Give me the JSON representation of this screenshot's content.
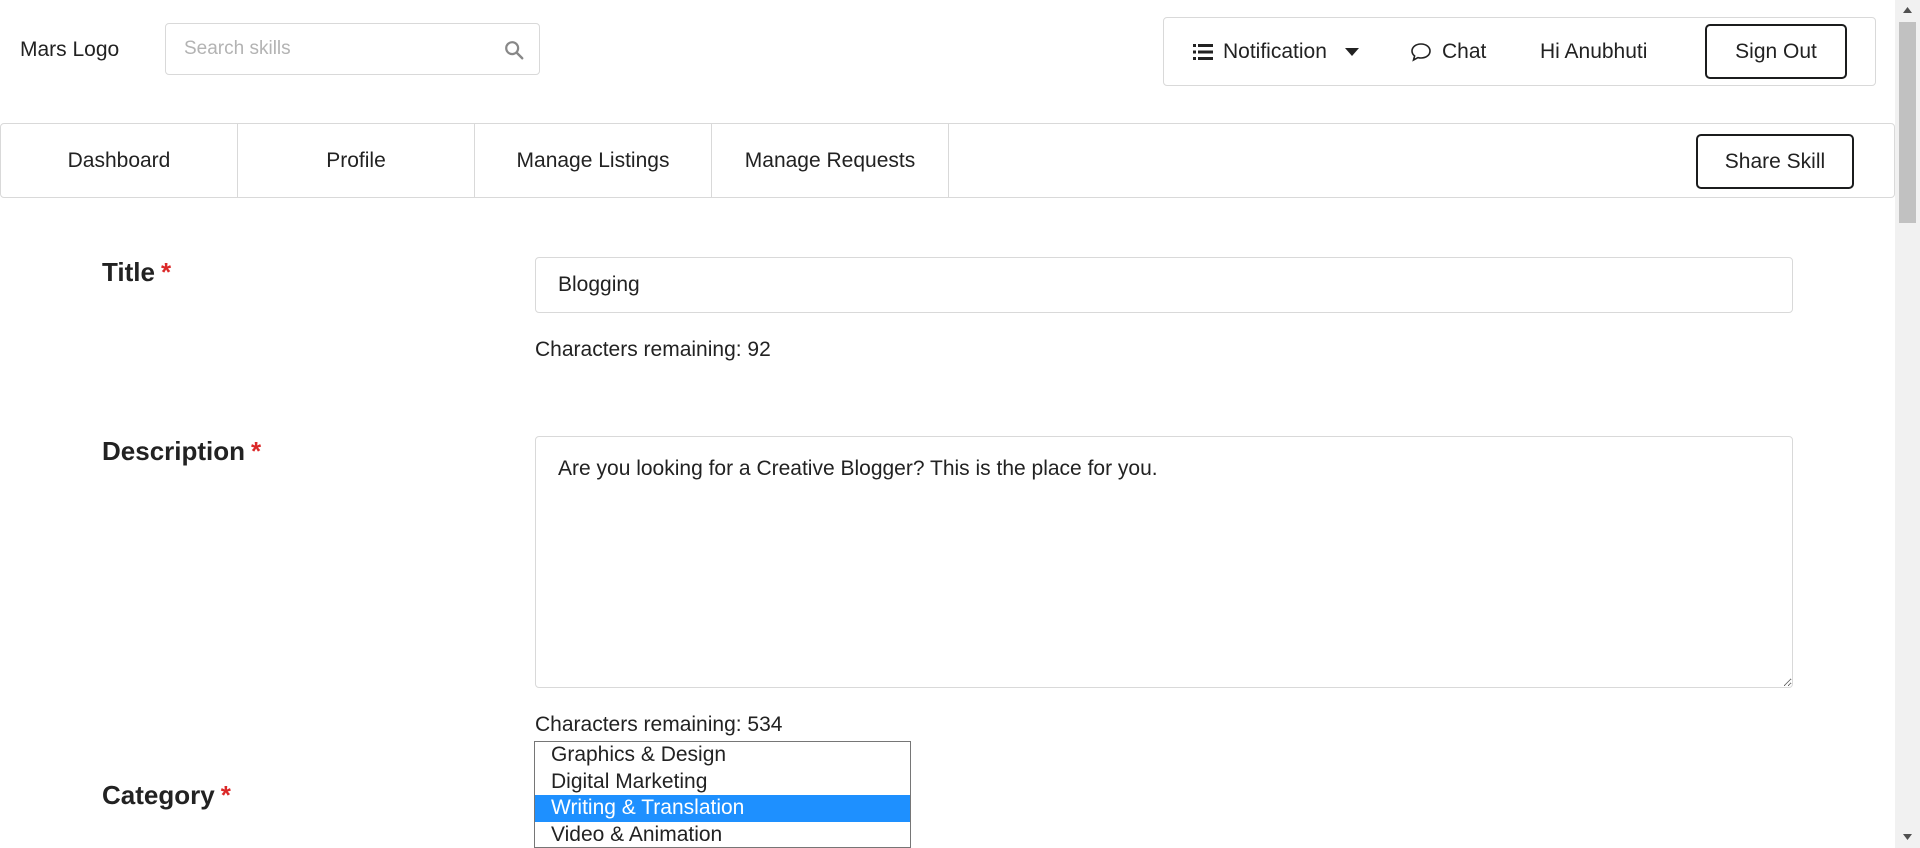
{
  "header": {
    "logo": "Mars Logo",
    "search": {
      "placeholder": "Search skills",
      "icon": "search-icon"
    },
    "menu": {
      "notification": "Notification",
      "chat": "Chat",
      "greeting": "Hi Anubhuti",
      "sign_out": "Sign Out"
    }
  },
  "nav": {
    "tabs": [
      "Dashboard",
      "Profile",
      "Manage Listings",
      "Manage Requests"
    ],
    "share_skill": "Share Skill"
  },
  "form": {
    "title": {
      "label": "Title",
      "required": "*",
      "value": "Blogging",
      "remaining": "Characters remaining: 92"
    },
    "description": {
      "label": "Description",
      "required": "*",
      "value": "Are you looking for a Creative Blogger? This is the place for you.",
      "remaining": "Characters remaining: 534"
    },
    "category": {
      "label": "Category",
      "required": "*",
      "options": [
        "Graphics & Design",
        "Digital Marketing",
        "Writing & Translation",
        "Video & Animation"
      ],
      "selected": "Writing & Translation"
    }
  },
  "colors": {
    "required": "#db2828",
    "selected_option": "#1e90ff",
    "border": "#d9d9d9"
  }
}
